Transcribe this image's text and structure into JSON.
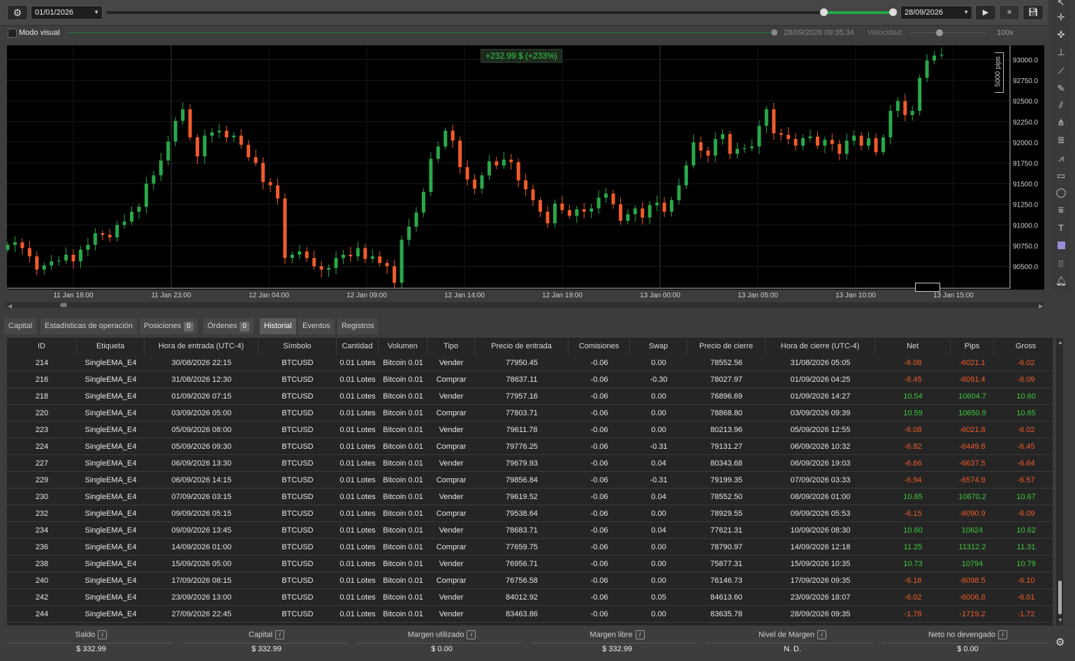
{
  "toolbar": {
    "start_date": "01/01/2026",
    "end_date": "28/09/2026",
    "visual_mode_label": "Modo visual",
    "current_time": "28/09/2026 09:35:34",
    "speed_label": "Velocidad:",
    "speed_value": "100x",
    "icons": [
      "gear-icon",
      "play-icon",
      "stop-icon",
      "save-icon"
    ]
  },
  "chart": {
    "pnl_badge": "+232.99 $ (+233%)",
    "scale_label": "5000 pips",
    "accent_up": "#2aa84a",
    "accent_down": "#f05b2b",
    "y_ticks": [
      "93000.0",
      "92750.0",
      "92500.0",
      "92250.0",
      "92000.0",
      "91750.0",
      "91500.0",
      "91250.0",
      "91000.0",
      "90750.0",
      "90500.0"
    ],
    "x_ticks": [
      "11 Jan 18:00",
      "11 Jan 23:00",
      "12 Jan 04:00",
      "12 Jan 09:00",
      "12 Jan 14:00",
      "12 Jan 19:00",
      "13 Jan 00:00",
      "13 Jan 05:00",
      "13 Jan 10:00",
      "13 Jan 15:00"
    ]
  },
  "chart_data": {
    "type": "candlestick",
    "x_ticks": [
      "11 Jan 18:00",
      "11 Jan 23:00",
      "12 Jan 04:00",
      "12 Jan 09:00",
      "12 Jan 14:00",
      "12 Jan 19:00",
      "13 Jan 00:00",
      "13 Jan 05:00",
      "13 Jan 10:00",
      "13 Jan 15:00"
    ],
    "ylim": [
      90300,
      93100
    ],
    "series": [
      {
        "closes": [
          90760,
          90790,
          90720,
          90620,
          90460,
          90510,
          90560,
          90570,
          90640,
          90560,
          90700,
          90760,
          90900,
          90880,
          90850,
          91000,
          91040,
          91160,
          91220,
          91500,
          91600,
          91780,
          92010,
          92260,
          92400,
          92060,
          91830,
          92080,
          92120,
          92140,
          92060,
          92080,
          91970,
          91820,
          91750,
          91520,
          91480,
          91320,
          90600,
          90640,
          90680,
          90600,
          90500,
          90460,
          90480,
          90600,
          90640,
          90620,
          90720,
          90590,
          90620,
          90540,
          90500,
          90300,
          90820,
          90980,
          91150,
          91400,
          91800,
          91950,
          92140,
          92020,
          91700,
          91550,
          91440,
          91600,
          91770,
          91720,
          91790,
          91760,
          91540,
          91430,
          91300,
          91160,
          91020,
          91260,
          91180,
          91110,
          91190,
          91160,
          91200,
          91330,
          91380,
          91250,
          91050,
          91130,
          91200,
          91090,
          91240,
          91270,
          91160,
          91300,
          91480,
          91720,
          92000,
          91900,
          91840,
          92040,
          92100,
          91860,
          91920,
          91930,
          91950,
          92200,
          92400,
          92110,
          92090,
          92040,
          91960,
          92050,
          92070,
          91960,
          92030,
          91980,
          91860,
          92020,
          92080,
          91960,
          92050,
          91880,
          92060,
          92380,
          92500,
          92330,
          92380,
          92780,
          92990,
          93050,
          93060
        ]
      }
    ]
  },
  "tabs": [
    {
      "label": "Capital"
    },
    {
      "label": "Estadísticas de operación"
    },
    {
      "label": "Posiciones",
      "badge": "0"
    },
    {
      "label": "Órdenes",
      "badge": "0"
    },
    {
      "label": "Historial"
    },
    {
      "label": "Eventos"
    },
    {
      "label": "Registros"
    }
  ],
  "table": {
    "columns": [
      "ID",
      "Etiqueta",
      "Hora de entrada (UTC-4)",
      "Símbolo",
      "Cantidad",
      "Volumen",
      "Tipo",
      "Precio de entrada",
      "Comisiones",
      "Swap",
      "Precio de cierre",
      "Hora de cierre (UTC-4)",
      "Net",
      "Pips",
      "Gross"
    ],
    "rows": [
      [
        "214",
        "SingleEMA_E4",
        "30/08/2026 22:15",
        "BTCUSD",
        "0.01 Lotes",
        "Bitcoin 0.01",
        "Vender",
        "77950.45",
        "-0.06",
        "0.00",
        "78552.56",
        "31/08/2026 05:05",
        "-6.08",
        "-6021.1",
        "-6.02"
      ],
      [
        "216",
        "SingleEMA_E4",
        "31/08/2026 12:30",
        "BTCUSD",
        "0.01 Lotes",
        "Bitcoin 0.01",
        "Comprar",
        "78637.11",
        "-0.06",
        "-0.30",
        "78027.97",
        "01/09/2026 04:25",
        "-6.45",
        "-6091.4",
        "-6.09"
      ],
      [
        "218",
        "SingleEMA_E4",
        "01/09/2026 07:15",
        "BTCUSD",
        "0.01 Lotes",
        "Bitcoin 0.01",
        "Vender",
        "77957.16",
        "-0.06",
        "0.00",
        "76896.69",
        "01/09/2026 14:27",
        "10.54",
        "10604.7",
        "10.60"
      ],
      [
        "220",
        "SingleEMA_E4",
        "03/09/2026 05:00",
        "BTCUSD",
        "0.01 Lotes",
        "Bitcoin 0.01",
        "Comprar",
        "77803.71",
        "-0.06",
        "0.00",
        "78868.80",
        "03/09/2026 09:39",
        "10.59",
        "10650.9",
        "10.65"
      ],
      [
        "223",
        "SingleEMA_E4",
        "05/09/2026 08:00",
        "BTCUSD",
        "0.01 Lotes",
        "Bitcoin 0.01",
        "Vender",
        "79611.78",
        "-0.06",
        "0.00",
        "80213.96",
        "05/09/2026 12:55",
        "-6.08",
        "-6021.8",
        "-6.02"
      ],
      [
        "224",
        "SingleEMA_E4",
        "05/09/2026 09:30",
        "BTCUSD",
        "0.01 Lotes",
        "Bitcoin 0.01",
        "Comprar",
        "79776.25",
        "-0.06",
        "-0.31",
        "79131.27",
        "06/09/2026 10:32",
        "-6.82",
        "-6449.8",
        "-6.45"
      ],
      [
        "227",
        "SingleEMA_E4",
        "06/09/2026 13:30",
        "BTCUSD",
        "0.01 Lotes",
        "Bitcoin 0.01",
        "Vender",
        "79679.93",
        "-0.06",
        "0.04",
        "80343.68",
        "06/09/2026 19:03",
        "-6.66",
        "-6637.5",
        "-6.64"
      ],
      [
        "229",
        "SingleEMA_E4",
        "06/09/2026 14:15",
        "BTCUSD",
        "0.01 Lotes",
        "Bitcoin 0.01",
        "Comprar",
        "79856.84",
        "-0.06",
        "-0.31",
        "79199.35",
        "07/09/2026 03:33",
        "-6.94",
        "-6574.9",
        "-6.57"
      ],
      [
        "230",
        "SingleEMA_E4",
        "07/09/2026 03:15",
        "BTCUSD",
        "0.01 Lotes",
        "Bitcoin 0.01",
        "Vender",
        "79619.52",
        "-0.06",
        "0.04",
        "78552.50",
        "08/09/2026 01:00",
        "10.65",
        "10670.2",
        "10.67"
      ],
      [
        "232",
        "SingleEMA_E4",
        "09/09/2026 05:15",
        "BTCUSD",
        "0.01 Lotes",
        "Bitcoin 0.01",
        "Comprar",
        "79538.64",
        "-0.06",
        "0.00",
        "78929.55",
        "09/09/2026 05:53",
        "-6.15",
        "-6090.9",
        "-6.09"
      ],
      [
        "234",
        "SingleEMA_E4",
        "09/09/2026 13:45",
        "BTCUSD",
        "0.01 Lotes",
        "Bitcoin 0.01",
        "Vender",
        "78683.71",
        "-0.06",
        "0.04",
        "77621.31",
        "10/09/2026 08:30",
        "10.60",
        "10624",
        "10.62"
      ],
      [
        "236",
        "SingleEMA_E4",
        "14/09/2026 01:00",
        "BTCUSD",
        "0.01 Lotes",
        "Bitcoin 0.01",
        "Comprar",
        "77659.75",
        "-0.06",
        "0.00",
        "78790.97",
        "14/09/2026 12:18",
        "11.25",
        "11312.2",
        "11.31"
      ],
      [
        "238",
        "SingleEMA_E4",
        "15/09/2026 05:00",
        "BTCUSD",
        "0.01 Lotes",
        "Bitcoin 0.01",
        "Vender",
        "76956.71",
        "-0.06",
        "0.00",
        "75877.31",
        "15/09/2026 10:35",
        "10.73",
        "10794",
        "10.79"
      ],
      [
        "240",
        "SingleEMA_E4",
        "17/09/2026 08:15",
        "BTCUSD",
        "0.01 Lotes",
        "Bitcoin 0.01",
        "Comprar",
        "76756.58",
        "-0.06",
        "0.00",
        "76146.73",
        "17/09/2026 09:35",
        "-6.16",
        "-6098.5",
        "-6.10"
      ],
      [
        "242",
        "SingleEMA_E4",
        "23/09/2026 13:00",
        "BTCUSD",
        "0.01 Lotes",
        "Bitcoin 0.01",
        "Vender",
        "84012.92",
        "-0.06",
        "0.05",
        "84613.60",
        "23/09/2026 18:07",
        "-6.02",
        "-6006.8",
        "-6.01"
      ],
      [
        "244",
        "SingleEMA_E4",
        "27/09/2026 22:45",
        "BTCUSD",
        "0.01 Lotes",
        "Bitcoin 0.01",
        "Vender",
        "83463.86",
        "-0.06",
        "0.00",
        "83635.78",
        "28/09/2026 09:35",
        "-1.78",
        "-1719.2",
        "-1.72"
      ]
    ]
  },
  "footer": [
    {
      "label": "Saldo",
      "value": "$ 332.99"
    },
    {
      "label": "Capital",
      "value": "$ 332.99"
    },
    {
      "label": "Margen utilizado",
      "value": "$ 0.00"
    },
    {
      "label": "Margen libre",
      "value": "$ 332.99"
    },
    {
      "label": "Nivel de Margen",
      "value": "N. D."
    },
    {
      "label": "Neto no devengado",
      "value": "$ 0.00"
    }
  ]
}
